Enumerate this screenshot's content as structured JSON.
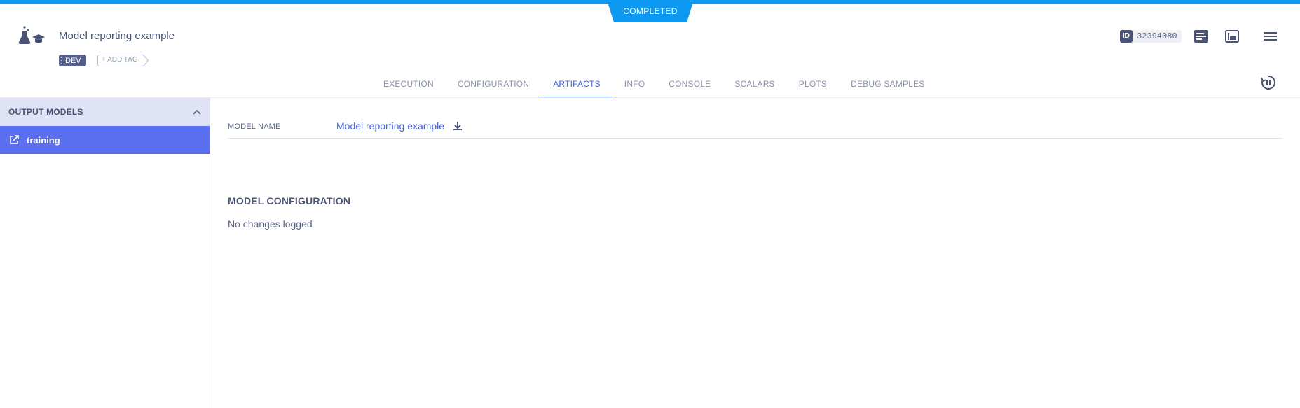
{
  "status": {
    "label": "COMPLETED",
    "color": "#0d99f2"
  },
  "task": {
    "title": "Model reporting example",
    "tags": [
      "DEV"
    ],
    "add_tag_label": "+ ADD TAG",
    "id_label": "ID",
    "id_value": "32394080"
  },
  "header_icons": [
    "task-type-icon",
    "details-icon",
    "layout-icon",
    "menu-icon",
    "auto-refresh-icon"
  ],
  "tabs": [
    {
      "label": "EXECUTION"
    },
    {
      "label": "CONFIGURATION"
    },
    {
      "label": "ARTIFACTS",
      "active": true
    },
    {
      "label": "INFO"
    },
    {
      "label": "CONSOLE"
    },
    {
      "label": "SCALARS"
    },
    {
      "label": "PLOTS"
    },
    {
      "label": "DEBUG SAMPLES"
    }
  ],
  "sidebar": {
    "section_title": "OUTPUT MODELS",
    "items": [
      {
        "label": "training",
        "selected": true
      }
    ]
  },
  "artifact": {
    "model_name_label": "MODEL NAME",
    "model_name_value": "Model reporting example",
    "config_title": "MODEL CONFIGURATION",
    "config_empty": "No changes logged"
  },
  "colors": {
    "accent": "#3f64d8",
    "selected_bg": "#5a70f0",
    "section_bg": "#dfe3f5"
  }
}
